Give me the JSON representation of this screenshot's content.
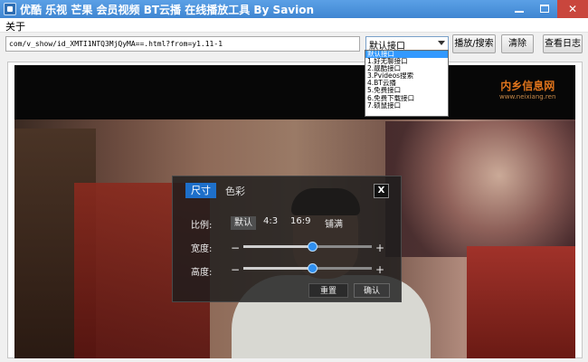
{
  "window": {
    "title": "优酷 乐视 芒果 会员视频 BT云播 在线播放工具 By Savion",
    "minimize_label": "",
    "close_label": "✕"
  },
  "menu": {
    "about": "关于"
  },
  "toolbar": {
    "url_value": "com/v_show/id_XMTI1NTQ3MjQyMA==.html?from=y1.11-1",
    "interface_selected": "默认接口",
    "play_search_label": "播放/搜索",
    "clear_label": "清除",
    "log_label": "查看日志"
  },
  "interface_options": [
    "默认接口",
    "1.好无聊接口",
    "2.靓酷接口",
    "3.Pvideos搜索",
    "4.BT云播",
    "5.免费接口",
    "6.免费下载接口",
    "7.硕鼠接口"
  ],
  "watermark": {
    "title": "内乡信息网",
    "url": "www.neixiang.ren"
  },
  "overlay": {
    "tab_size": "尺寸",
    "tab_color": "色彩",
    "close_label": "X",
    "ratio_label": "比例:",
    "ratio_options": [
      "默认",
      "4:3",
      "16:9",
      "铺满"
    ],
    "width_label": "宽度:",
    "height_label": "高度:",
    "minus": "−",
    "plus": "+",
    "width_level": 0.54,
    "height_level": 0.54,
    "reset_label": "重置",
    "confirm_label": "确认"
  },
  "colors": {
    "titlebar": "#3f86d2",
    "accent": "#1e6fc9",
    "slider_thumb": "#2f8ff0",
    "watermark": "#e0741c"
  }
}
